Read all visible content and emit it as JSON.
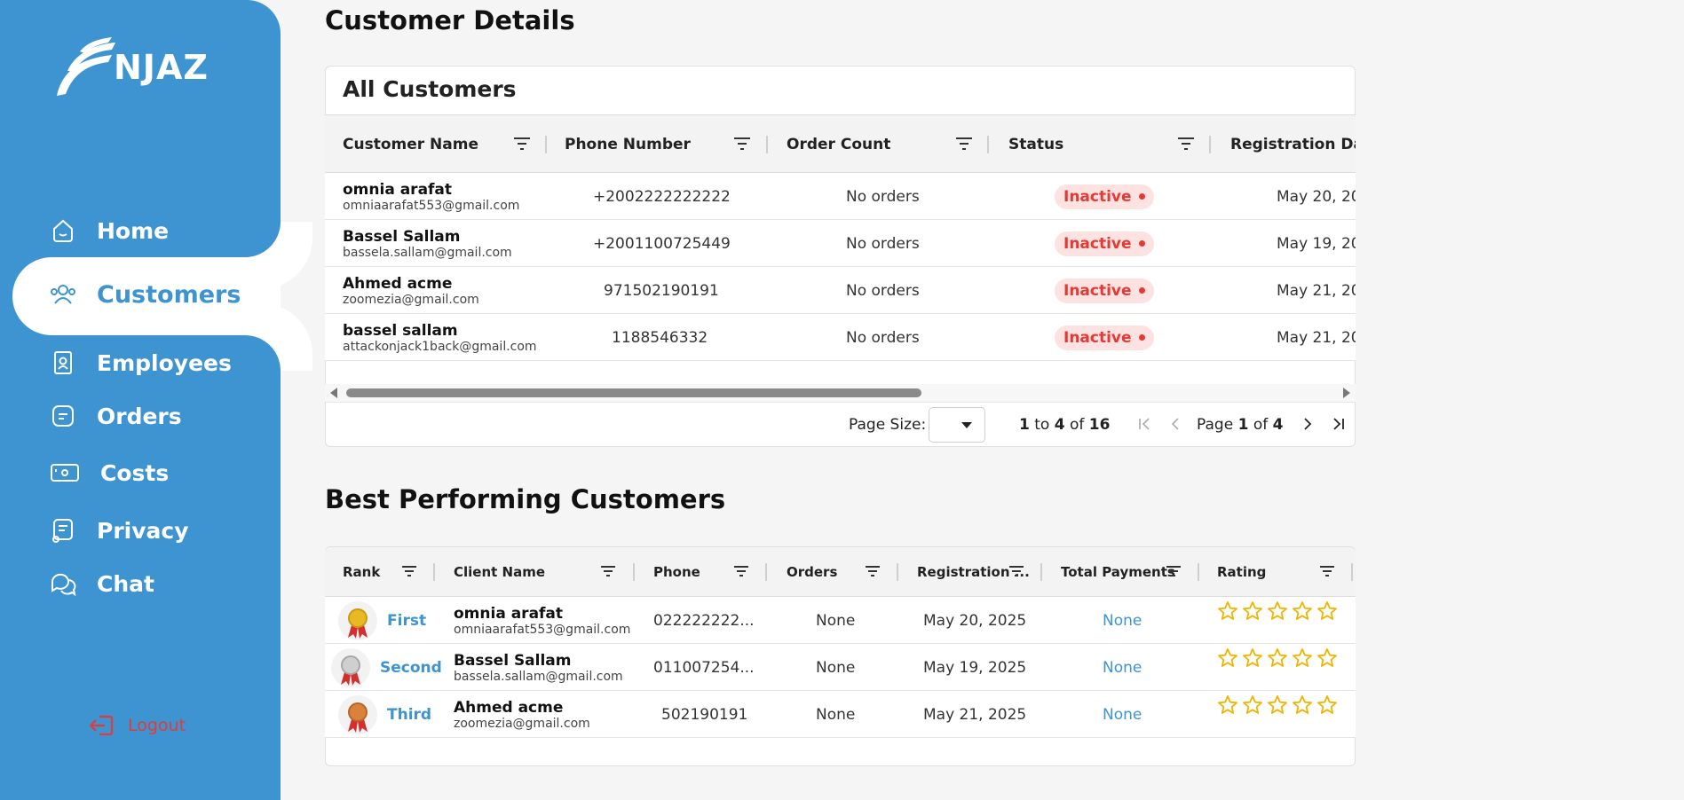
{
  "brand": {
    "name": "NJAZ"
  },
  "sidebar": {
    "items": [
      {
        "label": "Home",
        "icon": "home-icon"
      },
      {
        "label": "Customers",
        "icon": "users-icon"
      },
      {
        "label": "Employees",
        "icon": "id-badge-icon"
      },
      {
        "label": "Orders",
        "icon": "orders-icon"
      },
      {
        "label": "Costs",
        "icon": "money-icon"
      },
      {
        "label": "Privacy",
        "icon": "privacy-icon"
      },
      {
        "label": "Chat",
        "icon": "chat-icon"
      }
    ],
    "active": "Customers",
    "logout_label": "Logout"
  },
  "main": {
    "title": "Customer Details",
    "all_customers": {
      "title": "All Customers",
      "columns": [
        "Customer Name",
        "Phone Number",
        "Order Count",
        "Status",
        "Registration Date"
      ],
      "rows": [
        {
          "name": "omnia arafat",
          "email": "omniaarafat553@gmail.com",
          "phone": "+2002222222222",
          "orders": "No orders",
          "status": "Inactive",
          "date": "May 20, 20"
        },
        {
          "name": "Bassel Sallam",
          "email": "bassela.sallam@gmail.com",
          "phone": "+2001100725449",
          "orders": "No orders",
          "status": "Inactive",
          "date": "May 19, 20"
        },
        {
          "name": "Ahmed acme",
          "email": "zoomezia@gmail.com",
          "phone": "971502190191",
          "orders": "No orders",
          "status": "Inactive",
          "date": "May 21, 20"
        },
        {
          "name": "bassel sallam",
          "email": "attackonjack1back@gmail.com",
          "phone": "1188546332",
          "orders": "No orders",
          "status": "Inactive",
          "date": "May 21, 20"
        }
      ],
      "pager": {
        "page_size_label": "Page Size:",
        "range_from": "1",
        "range_to_word": "to",
        "range_to": "4",
        "range_of_word": "of",
        "range_total": "16",
        "page_word": "Page",
        "page_current": "1",
        "page_of_word": "of",
        "page_total": "4"
      }
    },
    "best": {
      "title": "Best Performing Customers",
      "columns": [
        "Rank",
        "Client Name",
        "Phone",
        "Orders",
        "Registration ...",
        "Total Payments",
        "Rating"
      ],
      "rows": [
        {
          "rank": "First",
          "medal_color": "#e8b923",
          "name": "omnia arafat",
          "email": "omniaarafat553@gmail.com",
          "phone": "022222222...",
          "orders": "None",
          "date": "May 20, 2025",
          "payments": "None",
          "rating": 0
        },
        {
          "rank": "Second",
          "medal_color": "#c7c7c7",
          "name": "Bassel Sallam",
          "email": "bassela.sallam@gmail.com",
          "phone": "011007254...",
          "orders": "None",
          "date": "May 19, 2025",
          "payments": "None",
          "rating": 0
        },
        {
          "rank": "Third",
          "medal_color": "#d9823b",
          "name": "Ahmed acme",
          "email": "zoomezia@gmail.com",
          "phone": "502190191",
          "orders": "None",
          "date": "May 21, 2025",
          "payments": "None",
          "rating": 0
        }
      ]
    }
  },
  "colors": {
    "primary": "#3d94d1",
    "danger": "#e53935",
    "star": "#f0b400"
  }
}
